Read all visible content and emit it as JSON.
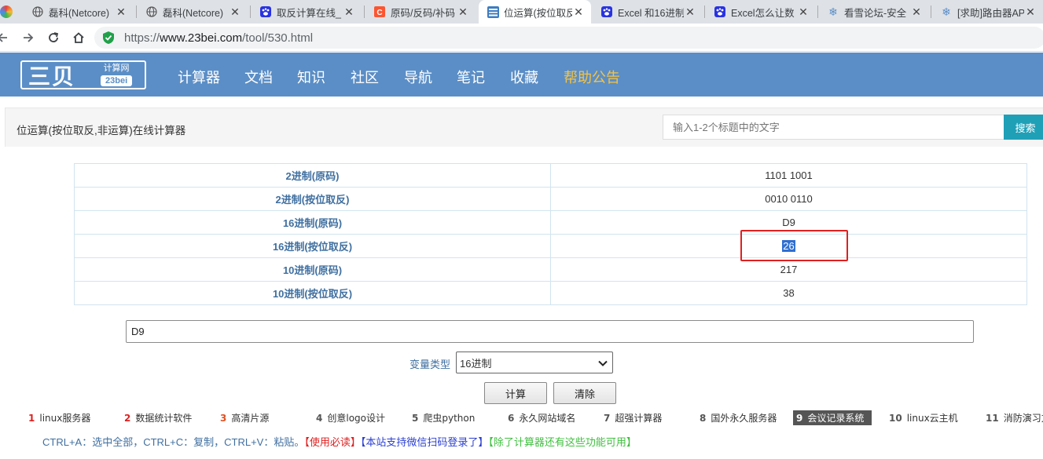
{
  "browser": {
    "tabs": [
      {
        "title": "磊科(Netcore)",
        "icon": "globe-icon"
      },
      {
        "title": "磊科(Netcore)",
        "icon": "globe-icon"
      },
      {
        "title": "取反计算在线_",
        "icon": "baidu-paw-icon"
      },
      {
        "title": "原码/反码/补码",
        "icon": "csdn-icon"
      },
      {
        "title": "位运算(按位取反",
        "icon": "site-23bei-icon"
      },
      {
        "title": "Excel 和16进制",
        "icon": "baidu-paw-icon"
      },
      {
        "title": "Excel怎么让数",
        "icon": "baidu-paw-icon"
      },
      {
        "title": "看雪论坛-安全",
        "icon": "snowflake-icon"
      },
      {
        "title": "[求助]路由器AP",
        "icon": "snowflake-icon"
      }
    ],
    "close_glyph": "✕",
    "url": {
      "scheme": "https://",
      "host": "www.23bei.com",
      "path": "/tool/530.html"
    }
  },
  "site": {
    "logo_main": "三贝",
    "logo_sub1": "计算网",
    "logo_sub2": "23bei",
    "nav": [
      "计算器",
      "文档",
      "知识",
      "社区",
      "导航",
      "笔记",
      "收藏",
      "帮助公告"
    ]
  },
  "page": {
    "title": "位运算(按位取反,非运算)在线计算器",
    "search_placeholder": "输入1-2个标题中的文字",
    "search_button": "搜索"
  },
  "results": [
    {
      "label": "2进制(原码)",
      "value": "1101 1001"
    },
    {
      "label": "2进制(按位取反)",
      "value": "0010 0110"
    },
    {
      "label": "16进制(原码)",
      "value": "D9"
    },
    {
      "label": "16进制(按位取反)",
      "value": "26"
    },
    {
      "label": "10进制(原码)",
      "value": "217"
    },
    {
      "label": "10进制(按位取反)",
      "value": "38"
    }
  ],
  "form": {
    "input_value": "D9",
    "var_type_label": "变量类型",
    "var_type_selected": "16进制",
    "calc_button": "计算",
    "clear_button": "清除"
  },
  "ads": [
    {
      "num": "1",
      "text": "linux服务器"
    },
    {
      "num": "2",
      "text": "数据统计软件"
    },
    {
      "num": "3",
      "text": "高清片源"
    },
    {
      "num": "4",
      "text": "创意logo设计"
    },
    {
      "num": "5",
      "text": "爬虫python"
    },
    {
      "num": "6",
      "text": "永久网站域名"
    },
    {
      "num": "7",
      "text": "超强计算器"
    },
    {
      "num": "8",
      "text": "国外永久服务器"
    },
    {
      "num": "9",
      "text": "会议记录系统"
    },
    {
      "num": "10",
      "text": "linux云主机"
    },
    {
      "num": "11",
      "text": "消防演习方"
    }
  ],
  "shortcuts": {
    "text": "CTRL+A：选中全部，CTRL+C：复制，CTRL+V：粘贴。",
    "link1": "【使用必读】",
    "link2": "【本站支持微信扫码登录了】",
    "link3": "【除了计算器还有这些功能可用】"
  },
  "colors": {
    "header": "#5b8ec6",
    "highlight_box": "#e02020",
    "search_button": "#1fa0b7"
  }
}
